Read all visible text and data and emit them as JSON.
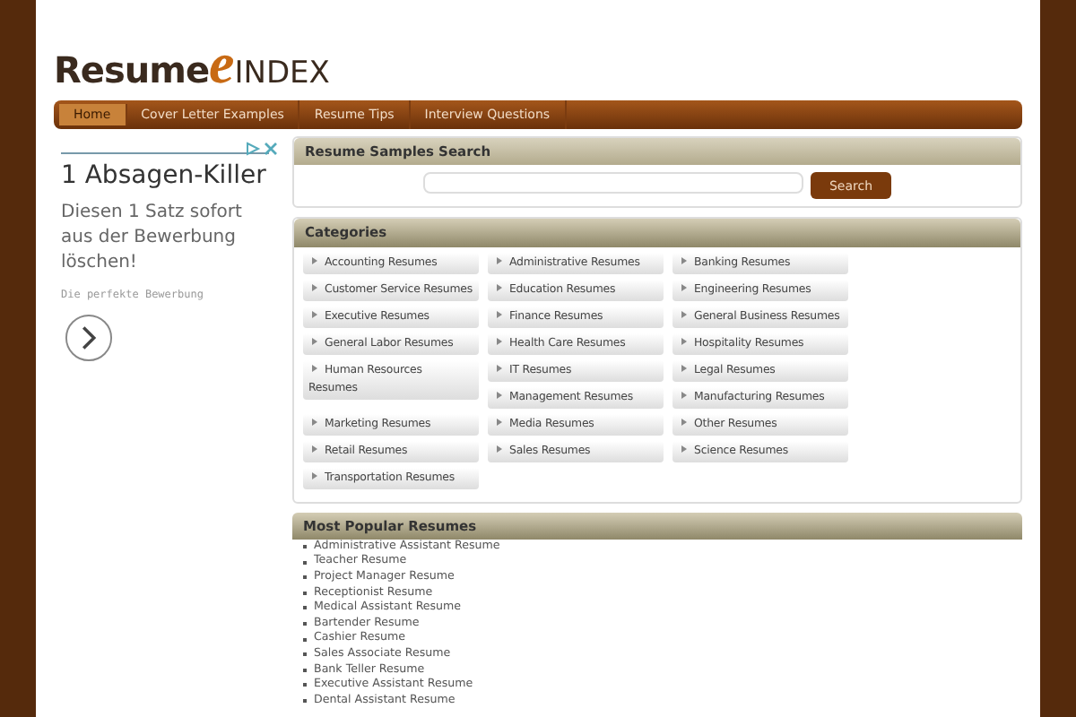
{
  "logo": {
    "part_1": "Resume",
    "part_2": "e",
    "part_3": "INDEX"
  },
  "nav": [
    {
      "label": "Home",
      "selected": true
    },
    {
      "label": "Cover Letter Examples",
      "selected": false
    },
    {
      "label": "Resume Tips",
      "selected": false
    },
    {
      "label": "Interview Questions",
      "selected": false
    }
  ],
  "ad": {
    "headline": "1 Absagen-Killer",
    "text": "Diesen 1 Satz sofort aus der Bewerbung löschen!",
    "source": "Die perfekte Bewerbung"
  },
  "search": {
    "title": "Resume Samples Search",
    "button": "Search"
  },
  "categories": {
    "title": "Categories",
    "items": [
      "Accounting Resumes",
      "Administrative Resumes",
      "Banking Resumes",
      "Customer Service Resumes",
      "Education Resumes",
      "Engineering Resumes",
      "Executive Resumes",
      "Finance Resumes",
      "General Business Resumes",
      "General Labor Resumes",
      "Health Care Resumes",
      "Hospitality Resumes",
      "Human Resources Resumes",
      "IT Resumes",
      "Legal Resumes",
      "Management Resumes",
      "Manufacturing Resumes",
      "Marketing Resumes",
      "Media Resumes",
      "Other Resumes",
      "Retail Resumes",
      "Sales Resumes",
      "Science Resumes",
      "Transportation Resumes"
    ]
  },
  "popular": {
    "title": "Most Popular Resumes",
    "items": [
      "Administrative Assistant Resume",
      "Teacher Resume",
      "Project Manager Resume",
      "Receptionist Resume",
      "Medical Assistant Resume",
      "Bartender Resume",
      "Cashier Resume",
      "Sales Associate Resume",
      "Bank Teller Resume",
      "Executive Assistant Resume",
      "Dental Assistant Resume"
    ]
  }
}
